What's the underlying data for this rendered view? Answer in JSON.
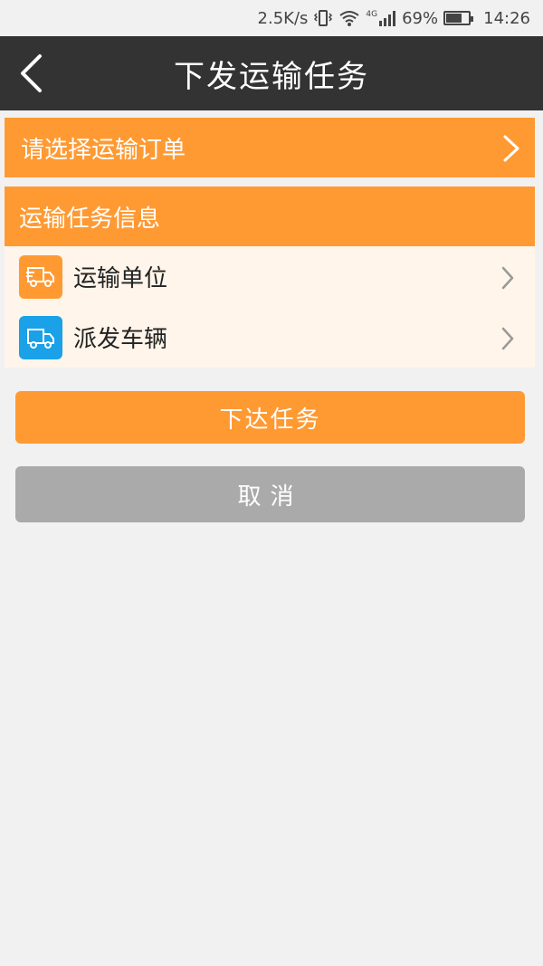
{
  "status_bar": {
    "net_speed": "2.5K/s",
    "network_type": "4G",
    "battery": "69%",
    "battery_level": 0.69,
    "time": "14:26",
    "icons": [
      "vibrate-icon",
      "wifi-icon",
      "signal-icon",
      "battery-icon"
    ]
  },
  "header": {
    "title": "下发运输任务",
    "back_icon": "chevron-left-icon"
  },
  "order_select": {
    "label": "请选择运输订单",
    "icon": "chevron-right-icon"
  },
  "info_section": {
    "title": "运输任务信息",
    "rows": [
      {
        "label": "运输单位",
        "icon": "delivery-truck-icon",
        "icon_color": "#ff9a33"
      },
      {
        "label": "派发车辆",
        "icon": "truck-icon",
        "icon_color": "#1aa1e8"
      }
    ]
  },
  "buttons": {
    "submit_label": "下达任务",
    "cancel_label": "取消"
  },
  "colors": {
    "accent": "#ff9a33",
    "title_bar": "#333333",
    "cancel": "#aaaaaa",
    "background": "#f1f1f1"
  }
}
